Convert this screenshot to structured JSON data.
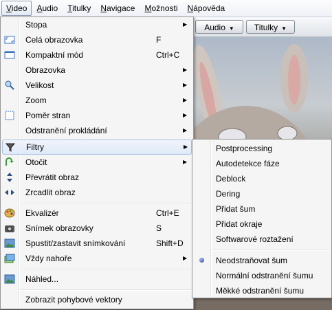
{
  "menubar": {
    "items": [
      {
        "label": "Video",
        "accel": "V",
        "rest": "ideo"
      },
      {
        "label": "Audio",
        "accel": "A",
        "rest": "udio"
      },
      {
        "label": "Titulky",
        "accel": "T",
        "rest": "itulky"
      },
      {
        "label": "Navigace",
        "accel": "N",
        "rest": "avigace"
      },
      {
        "label": "Možnosti",
        "accel": "M",
        "rest": "ožnosti"
      },
      {
        "label": "Nápověda",
        "accel": "N",
        "rest": "ápověda"
      }
    ]
  },
  "toolbar": {
    "audio_button": "Audio",
    "subtitles_button": "Titulky"
  },
  "video_menu": {
    "items": [
      {
        "label": "Stopa",
        "shortcut": "",
        "submenu": true,
        "icon": ""
      },
      {
        "label": "Celá obrazovka",
        "shortcut": "F",
        "submenu": false,
        "icon": "fullscreen-icon"
      },
      {
        "label": "Kompaktní mód",
        "shortcut": "Ctrl+C",
        "submenu": false,
        "icon": "compact-mode-icon"
      },
      {
        "label": "Obrazovka",
        "shortcut": "",
        "submenu": true,
        "icon": ""
      },
      {
        "label": "Velikost",
        "shortcut": "",
        "submenu": true,
        "icon": "magnifier-icon"
      },
      {
        "label": "Zoom",
        "shortcut": "",
        "submenu": true,
        "icon": ""
      },
      {
        "label": "Poměr stran",
        "shortcut": "",
        "submenu": true,
        "icon": "aspect-ratio-icon"
      },
      {
        "label": "Odstranění prokládání",
        "shortcut": "",
        "submenu": true,
        "icon": ""
      },
      {
        "label": "Filtry",
        "shortcut": "",
        "submenu": true,
        "icon": "filter-funnel-icon"
      },
      {
        "label": "Otočit",
        "shortcut": "",
        "submenu": true,
        "icon": "rotate-icon"
      },
      {
        "label": "Převrátit obraz",
        "shortcut": "",
        "submenu": false,
        "icon": "flip-icon"
      },
      {
        "label": "Zrcadlit obraz",
        "shortcut": "",
        "submenu": false,
        "icon": "mirror-icon"
      },
      {
        "label": "Ekvalizér",
        "shortcut": "Ctrl+E",
        "submenu": false,
        "icon": "palette-icon"
      },
      {
        "label": "Snímek obrazovky",
        "shortcut": "S",
        "submenu": false,
        "icon": "camera-icon"
      },
      {
        "label": "Spustit/zastavit snímkování",
        "shortcut": "Shift+D",
        "submenu": false,
        "icon": "screenshots-icon"
      },
      {
        "label": "Vždy nahoře",
        "shortcut": "",
        "submenu": true,
        "icon": "always-on-top-icon"
      },
      {
        "label": "Náhled...",
        "shortcut": "",
        "submenu": false,
        "icon": "preview-icon"
      },
      {
        "label": "Zobrazit pohybové vektory",
        "shortcut": "",
        "submenu": false,
        "icon": ""
      }
    ]
  },
  "filters_submenu": {
    "items": [
      {
        "label": "Postprocessing",
        "checked": false
      },
      {
        "label": "Autodetekce fáze",
        "checked": false
      },
      {
        "label": "Deblock",
        "checked": false
      },
      {
        "label": "Dering",
        "checked": false
      },
      {
        "label": "Přidat šum",
        "checked": false
      },
      {
        "label": "Přidat okraje",
        "checked": false
      },
      {
        "label": "Softwarové roztažení",
        "checked": false
      },
      {
        "label": "Neodstraňovat šum",
        "checked": true
      },
      {
        "label": "Normální odstranění šumu",
        "checked": false
      },
      {
        "label": "Měkké odstranění šumu",
        "checked": false
      }
    ]
  }
}
